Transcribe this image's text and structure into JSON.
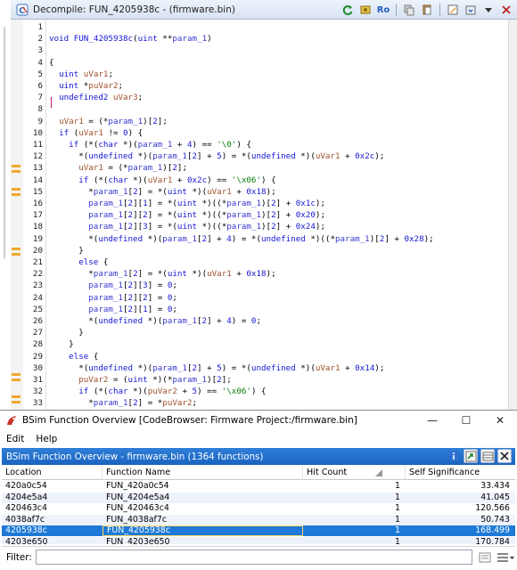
{
  "decompile": {
    "title": "Decompile: FUN_4205938c - (firmware.bin)",
    "toolbar": {
      "ro_label": "Ro",
      "icons": [
        "refresh-icon",
        "snapshot-icon",
        "read-only-icon",
        "copy-icon",
        "paste-icon",
        "edit-icon",
        "export-icon",
        "menu-icon",
        "close-icon"
      ]
    },
    "line_numbers": [
      "1",
      "2",
      "3",
      "4",
      "5",
      "6",
      "7",
      "8",
      "9",
      "10",
      "11",
      "12",
      "13",
      "14",
      "15",
      "16",
      "17",
      "18",
      "19",
      "20",
      "21",
      "22",
      "23",
      "24",
      "25",
      "26",
      "27",
      "28",
      "29",
      "30",
      "31",
      "32",
      "33"
    ],
    "code": [
      [],
      [
        [
          "kw",
          "void"
        ],
        [
          "p",
          " "
        ],
        [
          "fn",
          "FUN_4205938c"
        ],
        [
          "p",
          "("
        ],
        [
          "ty",
          "uint"
        ],
        [
          "p",
          " **"
        ],
        [
          "pr",
          "param_1"
        ],
        [
          "p",
          ")"
        ]
      ],
      [],
      [
        [
          "p",
          "{"
        ]
      ],
      [
        [
          "p",
          "  "
        ],
        [
          "ty",
          "uint"
        ],
        [
          "p",
          " "
        ],
        [
          "vr",
          "uVar1"
        ],
        [
          "p",
          ";"
        ]
      ],
      [
        [
          "p",
          "  "
        ],
        [
          "ty",
          "uint"
        ],
        [
          "p",
          " *"
        ],
        [
          "vr",
          "puVar2"
        ],
        [
          "p",
          ";"
        ]
      ],
      [
        [
          "p",
          "  "
        ],
        [
          "ty",
          "undefined2"
        ],
        [
          "p",
          " "
        ],
        [
          "vr",
          "uVar3"
        ],
        [
          "p",
          ";"
        ]
      ],
      [],
      [
        [
          "p",
          "  "
        ],
        [
          "vr",
          "uVar1"
        ],
        [
          "p",
          " = (*"
        ],
        [
          "pr",
          "param_1"
        ],
        [
          "p",
          ")["
        ],
        [
          "nm",
          "2"
        ],
        [
          "p",
          "];"
        ]
      ],
      [
        [
          "p",
          "  "
        ],
        [
          "kw",
          "if"
        ],
        [
          "p",
          " ("
        ],
        [
          "vr",
          "uVar1"
        ],
        [
          "p",
          " != "
        ],
        [
          "nm",
          "0"
        ],
        [
          "p",
          ") {"
        ]
      ],
      [
        [
          "p",
          "    "
        ],
        [
          "kw",
          "if"
        ],
        [
          "p",
          " (*("
        ],
        [
          "ty",
          "char"
        ],
        [
          "p",
          " *)("
        ],
        [
          "pr",
          "param_1"
        ],
        [
          "p",
          " + "
        ],
        [
          "nm",
          "4"
        ],
        [
          "p",
          ") == "
        ],
        [
          "st",
          "'\\0'"
        ],
        [
          "p",
          ") {"
        ]
      ],
      [
        [
          "p",
          "      *("
        ],
        [
          "ty",
          "undefined"
        ],
        [
          "p",
          " *)("
        ],
        [
          "pr",
          "param_1"
        ],
        [
          "p",
          "["
        ],
        [
          "nm",
          "2"
        ],
        [
          "p",
          "] + "
        ],
        [
          "nm",
          "5"
        ],
        [
          "p",
          ") = *("
        ],
        [
          "ty",
          "undefined"
        ],
        [
          "p",
          " *)("
        ],
        [
          "vr",
          "uVar1"
        ],
        [
          "p",
          " + "
        ],
        [
          "nm",
          "0x2c"
        ],
        [
          "p",
          ");"
        ]
      ],
      [
        [
          "p",
          "      "
        ],
        [
          "vr",
          "uVar1"
        ],
        [
          "p",
          " = (*"
        ],
        [
          "pr",
          "param_1"
        ],
        [
          "p",
          ")["
        ],
        [
          "nm",
          "2"
        ],
        [
          "p",
          "];"
        ]
      ],
      [
        [
          "p",
          "      "
        ],
        [
          "kw",
          "if"
        ],
        [
          "p",
          " (*("
        ],
        [
          "ty",
          "char"
        ],
        [
          "p",
          " *)("
        ],
        [
          "vr",
          "uVar1"
        ],
        [
          "p",
          " + "
        ],
        [
          "nm",
          "0x2c"
        ],
        [
          "p",
          ") == "
        ],
        [
          "st",
          "'\\x06'"
        ],
        [
          "p",
          ") {"
        ]
      ],
      [
        [
          "p",
          "        *"
        ],
        [
          "pr",
          "param_1"
        ],
        [
          "p",
          "["
        ],
        [
          "nm",
          "2"
        ],
        [
          "p",
          "] = *("
        ],
        [
          "ty",
          "uint"
        ],
        [
          "p",
          " *)("
        ],
        [
          "vr",
          "uVar1"
        ],
        [
          "p",
          " + "
        ],
        [
          "nm",
          "0x18"
        ],
        [
          "p",
          ");"
        ]
      ],
      [
        [
          "p",
          "        "
        ],
        [
          "pr",
          "param_1"
        ],
        [
          "p",
          "["
        ],
        [
          "nm",
          "2"
        ],
        [
          "p",
          "]["
        ],
        [
          "nm",
          "1"
        ],
        [
          "p",
          "] = *("
        ],
        [
          "ty",
          "uint"
        ],
        [
          "p",
          " *)((*"
        ],
        [
          "pr",
          "param_1"
        ],
        [
          "p",
          ")["
        ],
        [
          "nm",
          "2"
        ],
        [
          "p",
          "] + "
        ],
        [
          "nm",
          "0x1c"
        ],
        [
          "p",
          ");"
        ]
      ],
      [
        [
          "p",
          "        "
        ],
        [
          "pr",
          "param_1"
        ],
        [
          "p",
          "["
        ],
        [
          "nm",
          "2"
        ],
        [
          "p",
          "]["
        ],
        [
          "nm",
          "2"
        ],
        [
          "p",
          "] = *("
        ],
        [
          "ty",
          "uint"
        ],
        [
          "p",
          " *)((*"
        ],
        [
          "pr",
          "param_1"
        ],
        [
          "p",
          ")["
        ],
        [
          "nm",
          "2"
        ],
        [
          "p",
          "] + "
        ],
        [
          "nm",
          "0x20"
        ],
        [
          "p",
          ");"
        ]
      ],
      [
        [
          "p",
          "        "
        ],
        [
          "pr",
          "param_1"
        ],
        [
          "p",
          "["
        ],
        [
          "nm",
          "2"
        ],
        [
          "p",
          "]["
        ],
        [
          "nm",
          "3"
        ],
        [
          "p",
          "] = *("
        ],
        [
          "ty",
          "uint"
        ],
        [
          "p",
          " *)((*"
        ],
        [
          "pr",
          "param_1"
        ],
        [
          "p",
          ")["
        ],
        [
          "nm",
          "2"
        ],
        [
          "p",
          "] + "
        ],
        [
          "nm",
          "0x24"
        ],
        [
          "p",
          ");"
        ]
      ],
      [
        [
          "p",
          "        *("
        ],
        [
          "ty",
          "undefined"
        ],
        [
          "p",
          " *)("
        ],
        [
          "pr",
          "param_1"
        ],
        [
          "p",
          "["
        ],
        [
          "nm",
          "2"
        ],
        [
          "p",
          "] + "
        ],
        [
          "nm",
          "4"
        ],
        [
          "p",
          ") = *("
        ],
        [
          "ty",
          "undefined"
        ],
        [
          "p",
          " *)((*"
        ],
        [
          "pr",
          "param_1"
        ],
        [
          "p",
          ")["
        ],
        [
          "nm",
          "2"
        ],
        [
          "p",
          "] + "
        ],
        [
          "nm",
          "0x28"
        ],
        [
          "p",
          ");"
        ]
      ],
      [
        [
          "p",
          "      }"
        ]
      ],
      [
        [
          "p",
          "      "
        ],
        [
          "kw",
          "else"
        ],
        [
          "p",
          " {"
        ]
      ],
      [
        [
          "p",
          "        *"
        ],
        [
          "pr",
          "param_1"
        ],
        [
          "p",
          "["
        ],
        [
          "nm",
          "2"
        ],
        [
          "p",
          "] = *("
        ],
        [
          "ty",
          "uint"
        ],
        [
          "p",
          " *)("
        ],
        [
          "vr",
          "uVar1"
        ],
        [
          "p",
          " + "
        ],
        [
          "nm",
          "0x18"
        ],
        [
          "p",
          ");"
        ]
      ],
      [
        [
          "p",
          "        "
        ],
        [
          "pr",
          "param_1"
        ],
        [
          "p",
          "["
        ],
        [
          "nm",
          "2"
        ],
        [
          "p",
          "]["
        ],
        [
          "nm",
          "3"
        ],
        [
          "p",
          "] = "
        ],
        [
          "nm",
          "0"
        ],
        [
          "p",
          ";"
        ]
      ],
      [
        [
          "p",
          "        "
        ],
        [
          "pr",
          "param_1"
        ],
        [
          "p",
          "["
        ],
        [
          "nm",
          "2"
        ],
        [
          "p",
          "]["
        ],
        [
          "nm",
          "2"
        ],
        [
          "p",
          "] = "
        ],
        [
          "nm",
          "0"
        ],
        [
          "p",
          ";"
        ]
      ],
      [
        [
          "p",
          "        "
        ],
        [
          "pr",
          "param_1"
        ],
        [
          "p",
          "["
        ],
        [
          "nm",
          "2"
        ],
        [
          "p",
          "]["
        ],
        [
          "nm",
          "1"
        ],
        [
          "p",
          "] = "
        ],
        [
          "nm",
          "0"
        ],
        [
          "p",
          ";"
        ]
      ],
      [
        [
          "p",
          "        *("
        ],
        [
          "ty",
          "undefined"
        ],
        [
          "p",
          " *)("
        ],
        [
          "pr",
          "param_1"
        ],
        [
          "p",
          "["
        ],
        [
          "nm",
          "2"
        ],
        [
          "p",
          "] + "
        ],
        [
          "nm",
          "4"
        ],
        [
          "p",
          ") = "
        ],
        [
          "nm",
          "0"
        ],
        [
          "p",
          ";"
        ]
      ],
      [
        [
          "p",
          "      }"
        ]
      ],
      [
        [
          "p",
          "    }"
        ]
      ],
      [
        [
          "p",
          "    "
        ],
        [
          "kw",
          "else"
        ],
        [
          "p",
          " {"
        ]
      ],
      [
        [
          "p",
          "      *("
        ],
        [
          "ty",
          "undefined"
        ],
        [
          "p",
          " *)("
        ],
        [
          "pr",
          "param_1"
        ],
        [
          "p",
          "["
        ],
        [
          "nm",
          "2"
        ],
        [
          "p",
          "] + "
        ],
        [
          "nm",
          "5"
        ],
        [
          "p",
          ") = *("
        ],
        [
          "ty",
          "undefined"
        ],
        [
          "p",
          " *)("
        ],
        [
          "vr",
          "uVar1"
        ],
        [
          "p",
          " + "
        ],
        [
          "nm",
          "0x14"
        ],
        [
          "p",
          ");"
        ]
      ],
      [
        [
          "p",
          "      "
        ],
        [
          "vr",
          "puVar2"
        ],
        [
          "p",
          " = ("
        ],
        [
          "ty",
          "uint"
        ],
        [
          "p",
          " *)(*"
        ],
        [
          "pr",
          "param_1"
        ],
        [
          "p",
          ")["
        ],
        [
          "nm",
          "2"
        ],
        [
          "p",
          "];"
        ]
      ],
      [
        [
          "p",
          "      "
        ],
        [
          "kw",
          "if"
        ],
        [
          "p",
          " (*("
        ],
        [
          "ty",
          "char"
        ],
        [
          "p",
          " *)("
        ],
        [
          "vr",
          "puVar2"
        ],
        [
          "p",
          " + "
        ],
        [
          "nm",
          "5"
        ],
        [
          "p",
          ") == "
        ],
        [
          "st",
          "'\\x06'"
        ],
        [
          "p",
          ") {"
        ]
      ],
      [
        [
          "p",
          "        *"
        ],
        [
          "pr",
          "param_1"
        ],
        [
          "p",
          "["
        ],
        [
          "nm",
          "2"
        ],
        [
          "p",
          "] = *"
        ],
        [
          "vr",
          "puVar2"
        ],
        [
          "p",
          ";"
        ]
      ]
    ]
  },
  "bsim": {
    "window_title": "BSim Function Overview [CodeBrowser: Firmware Project:/firmware.bin]",
    "window_controls": {
      "minimize": "—",
      "maximize": "☐",
      "close": "✕"
    },
    "menu": [
      "Edit",
      "Help"
    ],
    "panel_title": "BSim Function Overview - firmware.bin (1364 functions)",
    "columns": [
      "Location",
      "Function Name",
      "Hit Count",
      "Self Significance"
    ],
    "rows": [
      {
        "location": "420a0c54",
        "name": "FUN_420a0c54",
        "hits": "1",
        "sig": "33.434"
      },
      {
        "location": "4204e5a4",
        "name": "FUN_4204e5a4",
        "hits": "1",
        "sig": "41.045"
      },
      {
        "location": "420463c4",
        "name": "FUN_420463c4",
        "hits": "1",
        "sig": "120.566"
      },
      {
        "location": "4038af7c",
        "name": "FUN_4038af7c",
        "hits": "1",
        "sig": "50.743"
      },
      {
        "location": "4205938c",
        "name": "FUN_4205938c",
        "hits": "1",
        "sig": "168.499",
        "selected": true
      },
      {
        "location": "4203e650",
        "name": "FUN_4203e650",
        "hits": "1",
        "sig": "170.784"
      }
    ],
    "filter": {
      "label": "Filter:",
      "value": ""
    }
  }
}
